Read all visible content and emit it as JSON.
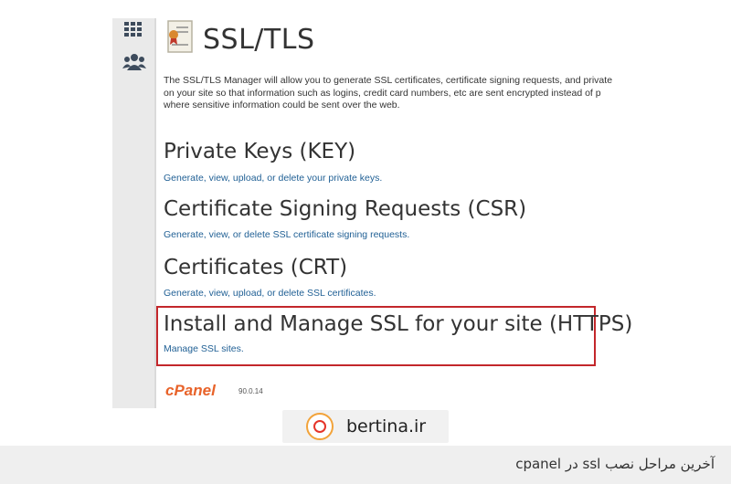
{
  "screenshot": {
    "page_title": "SSL/TLS",
    "intro_lines": [
      "The SSL/TLS Manager will allow you to generate SSL certificates, certificate signing requests, and private",
      "on your site so that information such as logins, credit card numbers, etc are sent encrypted instead of p",
      "where sensitive information could be sent over the web."
    ],
    "sections": [
      {
        "title": "Private Keys (KEY)",
        "link": "Generate, view, upload, or delete your private keys."
      },
      {
        "title": "Certificate Signing Requests (CSR)",
        "link": "Generate, view, or delete SSL certificate signing requests."
      },
      {
        "title": "Certificates (CRT)",
        "link": "Generate, view, upload, or delete SSL certificates."
      },
      {
        "title": "Install and Manage SSL for your site (HTTPS)",
        "link": "Manage SSL sites."
      }
    ],
    "footer": {
      "logo": "cPanel",
      "version": "90.0.14"
    },
    "highlight_color": "#c3272b",
    "link_color": "#1f5f94"
  },
  "brand": {
    "name": "bertina.ir"
  },
  "caption": "آخرین مراحل نصب ssl در cpanel",
  "icons": {
    "sidebar": [
      "grid-icon",
      "users-icon"
    ],
    "title": "certificate-icon"
  }
}
